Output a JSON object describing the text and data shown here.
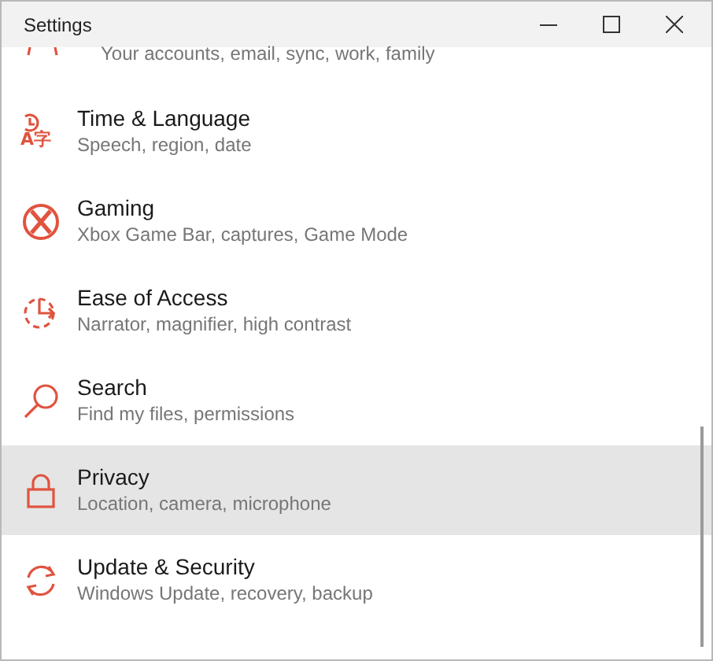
{
  "window": {
    "title": "Settings"
  },
  "items": [
    {
      "kind": "accounts",
      "subtitle": "Your accounts, email, sync, work, family",
      "selected": false
    },
    {
      "kind": "time",
      "title": "Time & Language",
      "subtitle": "Speech, region, date",
      "icon_text": "A字",
      "selected": false
    },
    {
      "kind": "gaming",
      "title": "Gaming",
      "subtitle": "Xbox Game Bar, captures, Game Mode",
      "selected": false
    },
    {
      "kind": "ease",
      "title": "Ease of Access",
      "subtitle": "Narrator, magnifier, high contrast",
      "selected": false
    },
    {
      "kind": "search",
      "title": "Search",
      "subtitle": "Find my files, permissions",
      "selected": false
    },
    {
      "kind": "privacy",
      "title": "Privacy",
      "subtitle": "Location, camera, microphone",
      "selected": true
    },
    {
      "kind": "update",
      "title": "Update & Security",
      "subtitle": "Windows Update, recovery, backup",
      "selected": false
    }
  ]
}
